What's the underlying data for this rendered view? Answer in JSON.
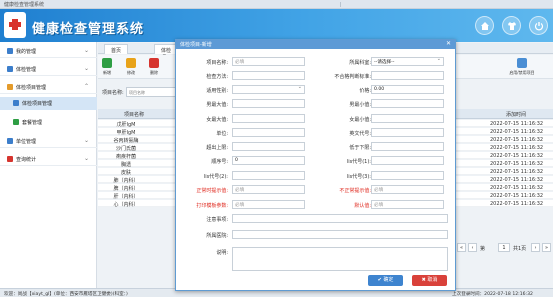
{
  "window": {
    "title": "健康检查管理系统"
  },
  "header": {
    "app_title": "健康检查管理系统"
  },
  "sidebar": {
    "items": [
      {
        "label": "我的管理",
        "arrow": "⌄"
      },
      {
        "label": "体检管理",
        "arrow": "⌄"
      },
      {
        "label": "体检项目管理",
        "arrow": "⌃"
      },
      {
        "label": "单位管理",
        "arrow": "⌄"
      },
      {
        "label": "查询统计",
        "arrow": "⌄"
      }
    ],
    "subitems": [
      {
        "label": "体检项目管理"
      },
      {
        "label": "套餐管理"
      }
    ]
  },
  "tabs": {
    "home": "首页",
    "active": "体检项目管理"
  },
  "toolbar": {
    "add": "新增",
    "edit": "修改",
    "delete": "删除",
    "other": "启用/禁用项目"
  },
  "search": {
    "label": "项目名称:",
    "placeholder": "项目名称"
  },
  "grid": {
    "col_name": "项目名称",
    "col_date": "添加时间",
    "rows": [
      {
        "name": "戊肝IgM",
        "date": "2022-07-15 11:16:32"
      },
      {
        "name": "甲肝IgM",
        "date": "2022-07-15 11:16:32"
      },
      {
        "name": "谷丙转氨酶",
        "date": "2022-07-15 11:16:32"
      },
      {
        "name": "沙门氏菌",
        "date": "2022-07-15 11:16:32"
      },
      {
        "name": "痢疾杆菌",
        "date": "2022-07-15 11:16:32"
      },
      {
        "name": "胸透",
        "date": "2022-07-15 11:16:32"
      },
      {
        "name": "皮肤",
        "date": "2022-07-15 11:16:32"
      },
      {
        "name": "肺（内科）",
        "date": "2022-07-15 11:16:32"
      },
      {
        "name": "脾（内科）",
        "date": "2022-07-15 11:16:32"
      },
      {
        "name": "肝（内科）",
        "date": "2022-07-15 11:16:32"
      },
      {
        "name": "心（内科）",
        "date": "2022-07-15 11:16:32"
      }
    ]
  },
  "pager": {
    "prev": "‹",
    "page": "1",
    "of": "共1页",
    "next": "›",
    "last": "»"
  },
  "statusbar": {
    "left": "欢迎：尚战【xiayt_gl】(单位：西安市雁塔区卫健委)(科室：)",
    "right": "上次登录时间：2022-07-18 12:16:32"
  },
  "modal": {
    "title": "体检项目-新增",
    "close": "✕",
    "fields": {
      "name": {
        "label": "项目名称:",
        "placeholder": "必填"
      },
      "category": {
        "label": "所属科室:",
        "value": "--请选择--"
      },
      "method": {
        "label": "检查方法:",
        "placeholder": ""
      },
      "unqualified": {
        "label": "不合格判断标准:",
        "placeholder": ""
      },
      "gender": {
        "label": "适用性别:",
        "placeholder": ""
      },
      "price": {
        "label": "价格:",
        "value": "0.00"
      },
      "male_max": {
        "label": "男最大值:",
        "placeholder": ""
      },
      "male_min": {
        "label": "男最小值:",
        "placeholder": ""
      },
      "female_max": {
        "label": "女最大值:",
        "placeholder": ""
      },
      "female_min": {
        "label": "女最小值:",
        "placeholder": ""
      },
      "unit": {
        "label": "单位:",
        "placeholder": ""
      },
      "english": {
        "label": "英文代号:",
        "placeholder": ""
      },
      "over_upper": {
        "label": "超出上限:",
        "placeholder": ""
      },
      "below_lower": {
        "label": "低于下限:",
        "placeholder": ""
      },
      "order": {
        "label": "顺序号:",
        "value": "0"
      },
      "lis1": {
        "label": "lis代号(1):",
        "placeholder": ""
      },
      "lis2": {
        "label": "lis代号(2):",
        "placeholder": ""
      },
      "lis3": {
        "label": "lis代号(3):",
        "placeholder": ""
      },
      "normal": {
        "label": "正常时提示值:",
        "placeholder": "必填"
      },
      "abnormal": {
        "label": "不正常提示值:",
        "placeholder": "必填"
      },
      "print": {
        "label": "打印模板参数:",
        "placeholder": "必填"
      },
      "default": {
        "label": "默认值:",
        "placeholder": "必填"
      },
      "notes": {
        "label": "注意事项:",
        "placeholder": ""
      },
      "related": {
        "label": "所属医院:",
        "placeholder": ""
      },
      "desc": {
        "label": "说明:",
        "placeholder": ""
      }
    },
    "ok": "✔ 确定",
    "cancel": "✖ 取消"
  }
}
